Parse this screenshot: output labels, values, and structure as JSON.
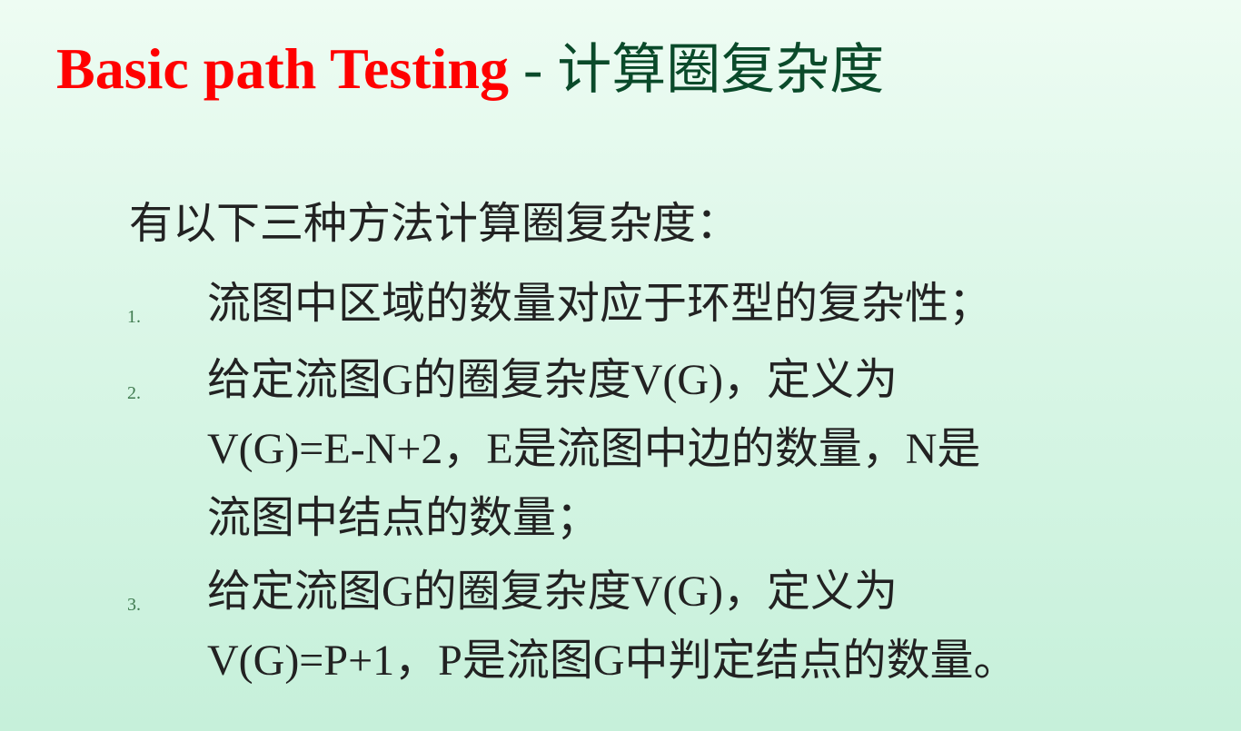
{
  "title": {
    "english": "Basic path Testing",
    "separator": " - ",
    "chinese": "计算圈复杂度"
  },
  "intro": "有以下三种方法计算圈复杂度：",
  "items": [
    {
      "number": "1.",
      "lines": [
        "流图中区域的数量对应于环型的复杂性；"
      ]
    },
    {
      "number": "2.",
      "lines": [
        "给定流图G的圈复杂度V(G)，定义为",
        "V(G)=E-N+2，E是流图中边的数量，N是",
        "流图中结点的数量；"
      ]
    },
    {
      "number": "3.",
      "lines": [
        "给定流图G的圈复杂度V(G)，定义为",
        "V(G)=P+1，P是流图G中判定结点的数量。"
      ]
    }
  ]
}
